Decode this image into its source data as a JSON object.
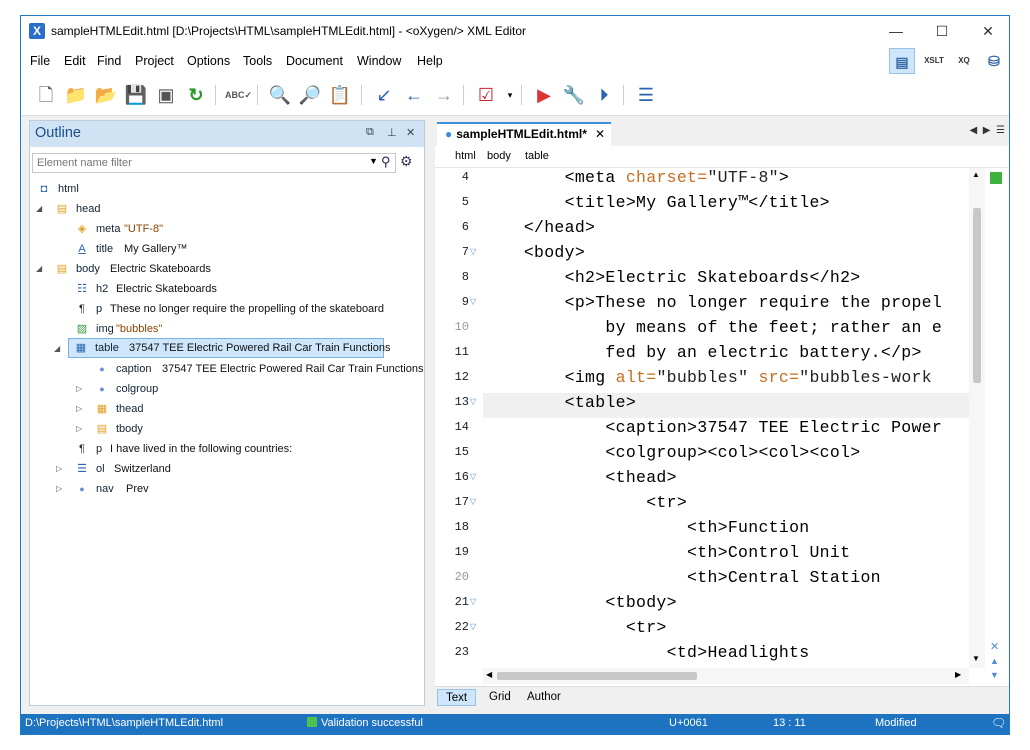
{
  "window": {
    "title": "sampleHTMLEdit.html [D:\\Projects\\HTML\\sampleHTMLEdit.html] - <oXygen/> XML Editor",
    "minimize": "—",
    "maximize": "☐",
    "close": "✕"
  },
  "menu": [
    "File",
    "Edit",
    "Find",
    "Project",
    "Options",
    "Tools",
    "Document",
    "Window",
    "Help"
  ],
  "perspectives": [
    "XSLT",
    "XQ"
  ],
  "outline": {
    "title": "Outline",
    "filter_placeholder": "Element name filter",
    "rows": [
      {
        "tag": "html",
        "attr": "",
        "text": ""
      },
      {
        "tag": "head",
        "attr": "",
        "text": ""
      },
      {
        "tag": "meta",
        "attr": "\"UTF-8\"",
        "text": ""
      },
      {
        "tag": "title",
        "attr": "",
        "text": "My Gallery™"
      },
      {
        "tag": "body",
        "attr": "",
        "text": "Electric Skateboards"
      },
      {
        "tag": "h2",
        "attr": "",
        "text": "Electric Skateboards"
      },
      {
        "tag": "p",
        "attr": "",
        "text": "These no longer require the propelling of the skateboard"
      },
      {
        "tag": "img",
        "attr": "\"bubbles\"",
        "text": ""
      },
      {
        "tag": "table",
        "attr": "",
        "text": "37547 TEE Electric Powered Rail Car Train Functions"
      },
      {
        "tag": "caption",
        "attr": "",
        "text": "37547 TEE Electric Powered Rail Car Train Functions"
      },
      {
        "tag": "colgroup",
        "attr": "",
        "text": ""
      },
      {
        "tag": "thead",
        "attr": "",
        "text": ""
      },
      {
        "tag": "tbody",
        "attr": "",
        "text": ""
      },
      {
        "tag": "p",
        "attr": "",
        "text": "I have lived in the following countries:"
      },
      {
        "tag": "ol",
        "attr": "",
        "text": "Switzerland"
      },
      {
        "tag": "nav",
        "attr": "",
        "text": "Prev"
      }
    ]
  },
  "editor": {
    "tab_label": "sampleHTMLEdit.html*",
    "breadcrumb": [
      "html",
      "body",
      "table"
    ],
    "line_numbers": [
      "4",
      "5",
      "6",
      "7",
      "8",
      "9",
      "10",
      "11",
      "12",
      "13",
      "14",
      "15",
      "16",
      "17",
      "18",
      "19",
      "20",
      "21",
      "22",
      "23"
    ],
    "lines": [
      {
        "indent": "        ",
        "pre": "<meta ",
        "ak": "charset=",
        "av": "\"UTF-8\"",
        "post": ">"
      },
      {
        "indent": "        ",
        "pre": "<title>My Gallery™</title>",
        "ak": "",
        "av": "",
        "post": ""
      },
      {
        "indent": "    ",
        "pre": "</head>",
        "ak": "",
        "av": "",
        "post": ""
      },
      {
        "indent": "    ",
        "pre": "<body>",
        "ak": "",
        "av": "",
        "post": ""
      },
      {
        "indent": "        ",
        "pre": "<h2>Electric Skateboards</h2>",
        "ak": "",
        "av": "",
        "post": ""
      },
      {
        "indent": "        ",
        "pre": "<p>These no longer require the propel",
        "ak": "",
        "av": "",
        "post": ""
      },
      {
        "indent": "            ",
        "pre": "by means of the feet; rather an e",
        "ak": "",
        "av": "",
        "post": ""
      },
      {
        "indent": "            ",
        "pre": "fed by an electric battery.</p>",
        "ak": "",
        "av": "",
        "post": ""
      },
      {
        "indent": "        ",
        "pre": "<img ",
        "ak": "alt=",
        "av": "\"bubbles\" ",
        "post": "",
        "ak2": "src=",
        "av2": "\"bubbles-work"
      },
      {
        "indent": "        ",
        "pre": "<table>",
        "ak": "",
        "av": "",
        "post": ""
      },
      {
        "indent": "            ",
        "pre": "<caption>37547 TEE Electric Power",
        "ak": "",
        "av": "",
        "post": ""
      },
      {
        "indent": "            ",
        "pre": "<colgroup><col><col><col>",
        "ak": "",
        "av": "",
        "post": ""
      },
      {
        "indent": "            ",
        "pre": "<thead>",
        "ak": "",
        "av": "",
        "post": ""
      },
      {
        "indent": "                ",
        "pre": "<tr>",
        "ak": "",
        "av": "",
        "post": ""
      },
      {
        "indent": "                    ",
        "pre": "<th>Function",
        "ak": "",
        "av": "",
        "post": ""
      },
      {
        "indent": "                    ",
        "pre": "<th>Control Unit",
        "ak": "",
        "av": "",
        "post": ""
      },
      {
        "indent": "                    ",
        "pre": "<th>Central Station",
        "ak": "",
        "av": "",
        "post": ""
      },
      {
        "indent": "            ",
        "pre": "<tbody>",
        "ak": "",
        "av": "",
        "post": ""
      },
      {
        "indent": "              ",
        "pre": "<tr>",
        "ak": "",
        "av": "",
        "post": ""
      },
      {
        "indent": "                  ",
        "pre": "<td>Headlights",
        "ak": "",
        "av": "",
        "post": ""
      }
    ],
    "mode_tabs": [
      "Text",
      "Grid",
      "Author"
    ]
  },
  "status": {
    "path": "D:\\Projects\\HTML\\sampleHTMLEdit.html",
    "validation": "Validation successful",
    "unicode": "U+0061",
    "position": "13 : 11",
    "state": "Modified"
  }
}
